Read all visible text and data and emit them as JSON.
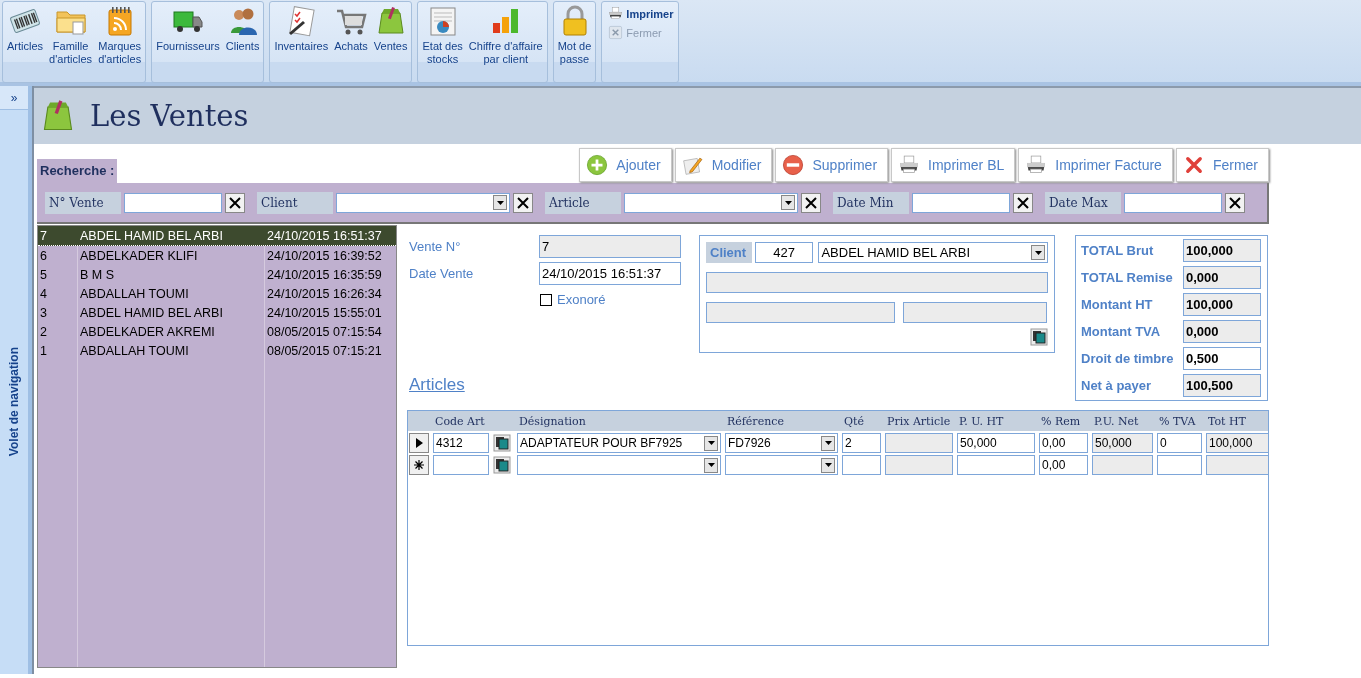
{
  "ribbon": {
    "groups": [
      {
        "kind": "large",
        "items": [
          {
            "label": "Articles"
          },
          {
            "label": "Famille\nd'articles"
          },
          {
            "label": "Marques\nd'articles"
          }
        ]
      },
      {
        "kind": "large",
        "items": [
          {
            "label": "Fournisseurs"
          },
          {
            "label": "Clients"
          }
        ]
      },
      {
        "kind": "large",
        "items": [
          {
            "label": "Inventaires"
          },
          {
            "label": "Achats"
          },
          {
            "label": "Ventes"
          }
        ]
      },
      {
        "kind": "large",
        "items": [
          {
            "label": "Etat des\nstocks"
          },
          {
            "label": "Chiffre d'affaire\npar client"
          }
        ]
      },
      {
        "kind": "large",
        "items": [
          {
            "label": "Mot de\npasse"
          }
        ]
      },
      {
        "kind": "small",
        "items": [
          {
            "label": "Imprimer",
            "disabled": false
          },
          {
            "label": "Fermer",
            "disabled": true
          }
        ]
      }
    ]
  },
  "nav_pane": {
    "toggle": "»",
    "title": "Volet de navigation"
  },
  "form": {
    "title": "Les Ventes"
  },
  "search_label": "Recherche :",
  "actions": [
    {
      "label": "Ajouter"
    },
    {
      "label": "Modifier"
    },
    {
      "label": "Supprimer"
    },
    {
      "label": "Imprimer BL"
    },
    {
      "label": "Imprimer Facture"
    },
    {
      "label": "Fermer"
    }
  ],
  "filters": [
    {
      "label": "N° Vente",
      "kind": "text"
    },
    {
      "label": "Client",
      "kind": "combo"
    },
    {
      "label": "Article",
      "kind": "combo"
    },
    {
      "label": "Date Min",
      "kind": "text"
    },
    {
      "label": "Date Max",
      "kind": "text"
    }
  ],
  "sales": [
    {
      "number": "7",
      "client": "ABDEL HAMID BEL ARBI",
      "date": "24/10/2015 16:51:37",
      "selected": true
    },
    {
      "number": "6",
      "client": "ABDELKADER KLIFI",
      "date": "24/10/2015 16:39:52",
      "selected": false
    },
    {
      "number": "5",
      "client": "B M S",
      "date": "24/10/2015 16:35:59",
      "selected": false
    },
    {
      "number": "4",
      "client": "ABDALLAH TOUMI",
      "date": "24/10/2015 16:26:34",
      "selected": false
    },
    {
      "number": "3",
      "client": "ABDEL HAMID BEL ARBI",
      "date": "24/10/2015 15:55:01",
      "selected": false
    },
    {
      "number": "2",
      "client": "ABDELKADER AKREMI",
      "date": "08/05/2015 07:15:54",
      "selected": false
    },
    {
      "number": "1",
      "client": "ABDALLAH TOUMI",
      "date": "08/05/2015 07:15:21",
      "selected": false
    }
  ],
  "sale": {
    "number": {
      "label": "Vente N°",
      "value": "7",
      "disabled": true
    },
    "date": {
      "label": "Date Vente",
      "value": "24/10/2015 16:51:37",
      "disabled": false
    },
    "exonore": {
      "label": "Exonoré",
      "checked": false
    }
  },
  "client": {
    "label": "Client",
    "code": "427",
    "name": "ABDEL HAMID BEL ARBI"
  },
  "totals": [
    {
      "label": "TOTAL Brut",
      "value": "100,000",
      "disabled": true
    },
    {
      "label": "TOTAL Remise",
      "value": "0,000",
      "disabled": true
    },
    {
      "label": "Montant HT",
      "value": "100,000",
      "disabled": true
    },
    {
      "label": "Montant TVA",
      "value": "0,000",
      "disabled": true
    },
    {
      "label": "Droit de timbre",
      "value": "0,500",
      "disabled": false
    },
    {
      "label": "Net à payer",
      "value": "100,500",
      "disabled": true
    }
  ],
  "articles": {
    "title": "Articles",
    "columns": [
      {
        "label": "Code Art",
        "kind": "text"
      },
      {
        "label": "Désignation",
        "kind": "combo"
      },
      {
        "label": "Référence",
        "kind": "combo"
      },
      {
        "label": "Qté",
        "kind": "text"
      },
      {
        "label": "Prix Article",
        "kind": "readonly"
      },
      {
        "label": "P. U.  HT",
        "kind": "text"
      },
      {
        "label": "% Rem",
        "kind": "text"
      },
      {
        "label": "P.U.  Net",
        "kind": "readonly"
      },
      {
        "label": "% TVA",
        "kind": "text"
      },
      {
        "label": "Tot HT",
        "kind": "readonly"
      }
    ],
    "rows": [
      {
        "kind": "current",
        "cells": [
          "4312",
          "ADAPTATEUR POUR BF7925",
          "FD7926",
          "2",
          null,
          "50,000",
          "0,00",
          "50,000",
          "0",
          "100,000"
        ]
      },
      {
        "kind": "new",
        "cells": [
          null,
          null,
          null,
          null,
          null,
          null,
          "0,00",
          null,
          null,
          null
        ]
      }
    ]
  }
}
